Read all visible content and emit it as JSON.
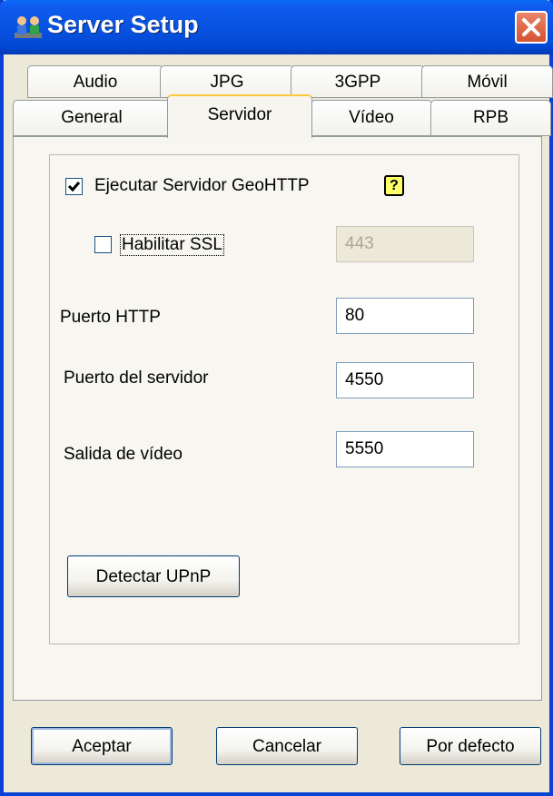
{
  "window": {
    "title": "Server Setup",
    "app_icon": "users-network-icon",
    "close_icon": "close-icon"
  },
  "tabs": {
    "row_top": [
      "Audio",
      "JPG",
      "3GPP",
      "Móvil"
    ],
    "row_bottom": [
      "General",
      "Servidor",
      "Vídeo",
      "RPB"
    ],
    "active": "Servidor"
  },
  "servidor": {
    "run_server_label": "Ejecutar Servidor GeoHTTP",
    "run_server_checked": true,
    "help_icon": "help-question-icon",
    "help_glyph": "?",
    "ssl_label": "Habilitar SSL",
    "ssl_checked": false,
    "ssl_port": "443",
    "http_port_label": "Puerto HTTP",
    "http_port": "80",
    "server_port_label": "Puerto del servidor",
    "server_port": "4550",
    "video_out_label": "Salida de vídeo",
    "video_out_port": "5550",
    "upnp_button": "Detectar UPnP"
  },
  "footer": {
    "ok": "Aceptar",
    "cancel": "Cancelar",
    "defaults": "Por defecto"
  }
}
